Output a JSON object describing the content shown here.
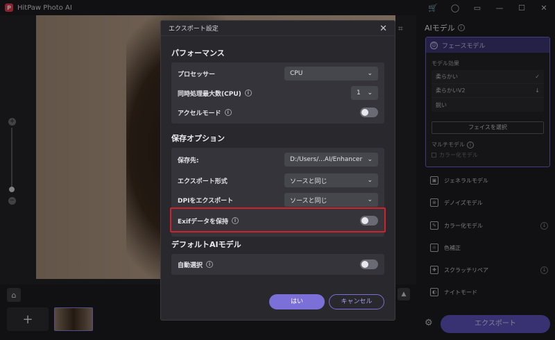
{
  "app": {
    "logo_letter": "P",
    "title": "HitPaw Photo AI"
  },
  "titlebar": {
    "icons": [
      "cart-icon",
      "user-icon",
      "chat-icon",
      "minimize-icon",
      "maximize-icon",
      "close-icon"
    ]
  },
  "right_panel": {
    "title": "AIモデル",
    "face_model": {
      "label": "フェースモデル",
      "effect_label": "モデル効果",
      "effects": [
        {
          "label": "柔らかい",
          "state": "selected"
        },
        {
          "label": "柔らかいV2",
          "state": "download"
        },
        {
          "label": "鋭い",
          "state": "none"
        }
      ],
      "select_face_button": "フェイスを選択",
      "multi_model_label": "マルチモデル",
      "color_model_checkbox": "カラー化モデル"
    },
    "models": [
      {
        "label": "ジェネラルモデル",
        "download": false
      },
      {
        "label": "デノイズモデル",
        "download": false
      },
      {
        "label": "カラー化モデル",
        "download": true
      },
      {
        "label": "色補正",
        "download": false
      },
      {
        "label": "スクラッチリペア",
        "download": true
      },
      {
        "label": "ナイトモード",
        "download": false
      }
    ],
    "export_button": "エクスポート"
  },
  "dialog": {
    "title": "エクスポート設定",
    "performance": {
      "title": "パフォーマンス",
      "processor_label": "プロセッサー",
      "processor_value": "CPU",
      "concurrent_label": "同時処理最大数(CPU)",
      "concurrent_value": "1",
      "accel_label": "アクセルモード",
      "accel_on": false
    },
    "save_options": {
      "title": "保存オプション",
      "dest_label": "保存先:",
      "dest_value": "D:/Users/...AI/Enhancer",
      "format_label": "エクスポート形式",
      "format_value": "ソースと同じ",
      "dpi_label": "DPIをエクスポート",
      "dpi_value": "ソースと同じ",
      "exif_label": "Exifデータを保持",
      "exif_on": false
    },
    "default_ai": {
      "title": "デフォルトAIモデル",
      "auto_label": "自動選択",
      "auto_on": false
    },
    "yes_button": "はい",
    "cancel_button": "キャンセル"
  },
  "colors": {
    "accent": "#7b70d8",
    "highlight": "#d0222c",
    "dialog_bg": "#28282d"
  }
}
